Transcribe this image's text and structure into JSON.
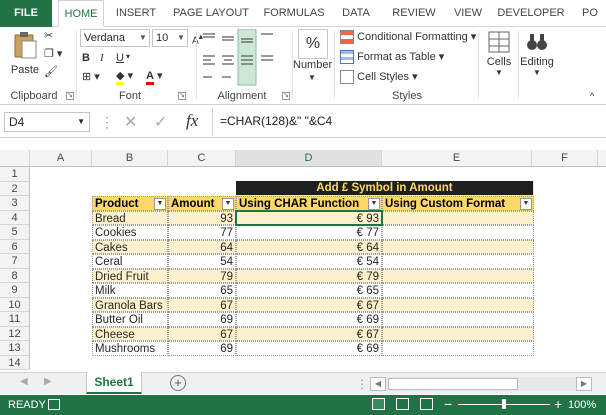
{
  "tabs": [
    "FILE",
    "HOME",
    "INSERT",
    "PAGE LAYOUT",
    "FORMULAS",
    "DATA",
    "REVIEW",
    "VIEW",
    "DEVELOPER",
    "PO"
  ],
  "clipboard": {
    "paste": "Paste",
    "label": "Clipboard"
  },
  "font": {
    "name": "Verdana",
    "size": "10",
    "label": "Font",
    "bold": "B",
    "italic": "I",
    "underline": "U"
  },
  "alignment": {
    "label": "Alignment"
  },
  "number": {
    "label": "Number",
    "symbol": "%"
  },
  "styles": {
    "conditional": "Conditional Formatting",
    "format_table": "Format as Table",
    "cell_styles": "Cell Styles",
    "label": "Styles"
  },
  "cells": {
    "label": "Cells"
  },
  "editing": {
    "label": "Editing"
  },
  "formula_bar": {
    "name_box": "D4",
    "fx": "fx",
    "formula": "=CHAR(128)&\" \"&C4"
  },
  "columns": [
    "A",
    "B",
    "C",
    "D",
    "E",
    "F"
  ],
  "rows": [
    "1",
    "2",
    "3",
    "4",
    "5",
    "6",
    "7",
    "8",
    "9",
    "10",
    "11",
    "12",
    "13",
    "14"
  ],
  "table": {
    "title": "Add £ Symbol in Amount",
    "headers": [
      "Product",
      "Amount",
      "Using CHAR Function",
      "Using Custom Format"
    ],
    "rows": [
      {
        "product": "Bread",
        "amount": "93",
        "char": "€ 93"
      },
      {
        "product": "Cookies",
        "amount": "77",
        "char": "€ 77"
      },
      {
        "product": "Cakes",
        "amount": "64",
        "char": "€ 64"
      },
      {
        "product": "Ceral",
        "amount": "54",
        "char": "€ 54"
      },
      {
        "product": "Dried Fruit",
        "amount": "79",
        "char": "€ 79"
      },
      {
        "product": "Milk",
        "amount": "65",
        "char": "€ 65"
      },
      {
        "product": "Granola Bars",
        "amount": "67",
        "char": "€ 67"
      },
      {
        "product": "Butter Oil",
        "amount": "69",
        "char": "€ 69"
      },
      {
        "product": "Cheese",
        "amount": "67",
        "char": "€ 67"
      },
      {
        "product": "Mushrooms",
        "amount": "69",
        "char": "€ 69"
      }
    ]
  },
  "sheet_tab": "Sheet1",
  "status": {
    "ready": "READY",
    "zoom": "100%",
    "minus": "−",
    "plus": "+"
  },
  "colors": {
    "brand": "#217346",
    "header_fill": "#fbd869",
    "band_fill": "#fdf0cc",
    "title_fill": "#1f1f1f"
  }
}
